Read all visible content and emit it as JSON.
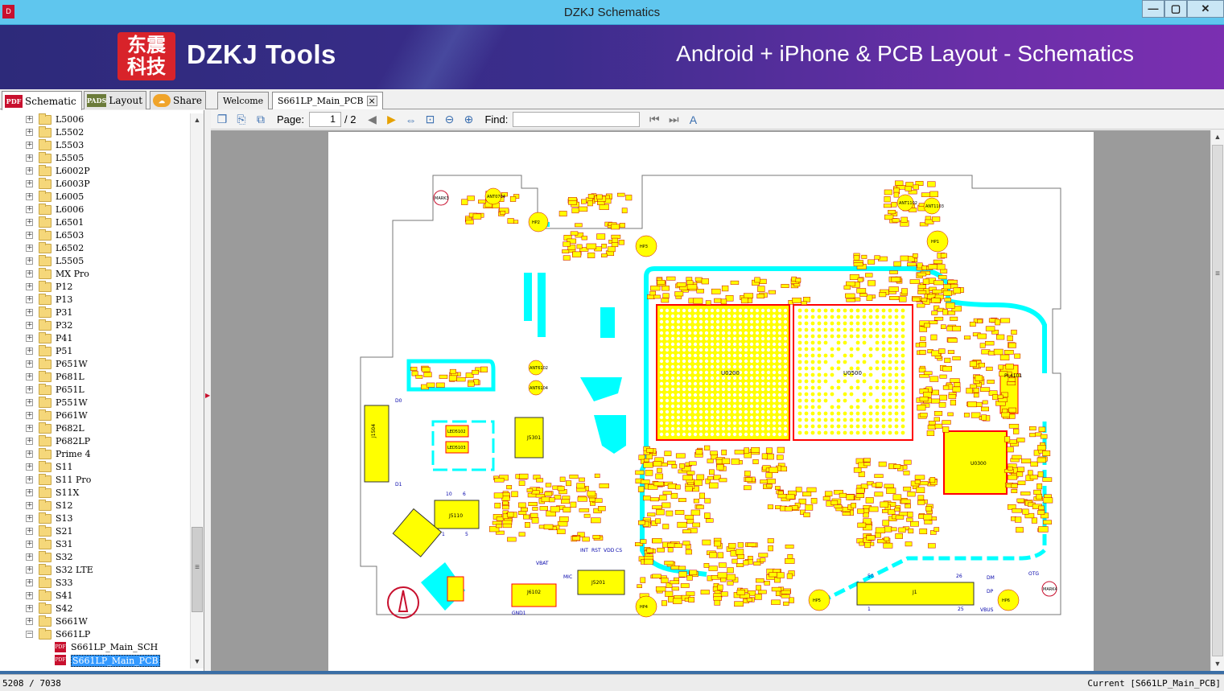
{
  "window": {
    "title": "DZKJ Schematics",
    "app_icon": "app-logo-icon",
    "minimize": "—",
    "maximize": "▢",
    "close": "✕"
  },
  "banner": {
    "logo_text": "东震科技",
    "brand": "DZKJ Tools",
    "tagline": "Android + iPhone & PCB Layout - Schematics"
  },
  "nav_tabs": [
    {
      "label": "Schematic",
      "icon": "PDF",
      "active": true
    },
    {
      "label": "Layout",
      "icon": "PADS"
    },
    {
      "label": "Share",
      "icon": "share-cloud-icon"
    }
  ],
  "doc_tabs": [
    {
      "label": "Welcome"
    },
    {
      "label": "S661LP_Main_PCB",
      "active": true
    }
  ],
  "toolbar": {
    "page_label": "Page:",
    "page_current": "1",
    "page_total": "/ 2",
    "find_label": "Find:",
    "find_value": ""
  },
  "tree": {
    "folders": [
      "L5006",
      "L5502",
      "L5503",
      "L5505",
      "L6002P",
      "L6003P",
      "L6005",
      "L6006",
      "L6501",
      "L6503",
      "L6502",
      "L5505",
      "MX Pro",
      "P12",
      "P13",
      "P31",
      "P32",
      "P41",
      "P51",
      "P651W",
      "P681L",
      "P651L",
      "P551W",
      "P661W",
      "P682L",
      "P682LP",
      "Prime 4",
      "S11",
      "S11 Pro",
      "S11X",
      "S12",
      "S13",
      "S21",
      "S31",
      "S32",
      "S32 LTE",
      "S33",
      "S41",
      "S42",
      "S661W",
      "S661LP"
    ],
    "expanded_folder": "S661LP",
    "children": [
      "S661LP_Main_SCH",
      "S661LP_Main_PCB"
    ],
    "selected": "S661LP_Main_PCB"
  },
  "status": {
    "left": "5208 / 7038",
    "right": "Current [S661LP_Main_PCB]"
  },
  "pcb": {
    "chips": [
      "U0200",
      "U0500",
      "U0300",
      "J1504",
      "J5110",
      "J5107",
      "J5201",
      "J6102",
      "J5301",
      "PL4101",
      "LED5102",
      "LED5103",
      "LED6106"
    ],
    "pads": [
      "MARK3",
      "ANT0704",
      "HP2",
      "HP3",
      "HP1",
      "HP4",
      "HP5",
      "HP6",
      "HP7",
      "WP1",
      "MARK4",
      "ANT1102",
      "ANT1103",
      "ANT6102",
      "ANT6104"
    ],
    "pin_labels": [
      "10",
      "6",
      "5",
      "1",
      "50",
      "26",
      "25",
      "1",
      "D0",
      "D1",
      "VBAT",
      "MIC",
      "DM",
      "DP",
      "VBUS",
      "OTG",
      "GND1",
      "INT",
      "RST",
      "VDD",
      "CS"
    ],
    "colors": {
      "board_outline": "#777777",
      "component": "#ffff00",
      "copper": "#00ffff",
      "silk": "#ff0000",
      "label": "#0000aa"
    }
  }
}
